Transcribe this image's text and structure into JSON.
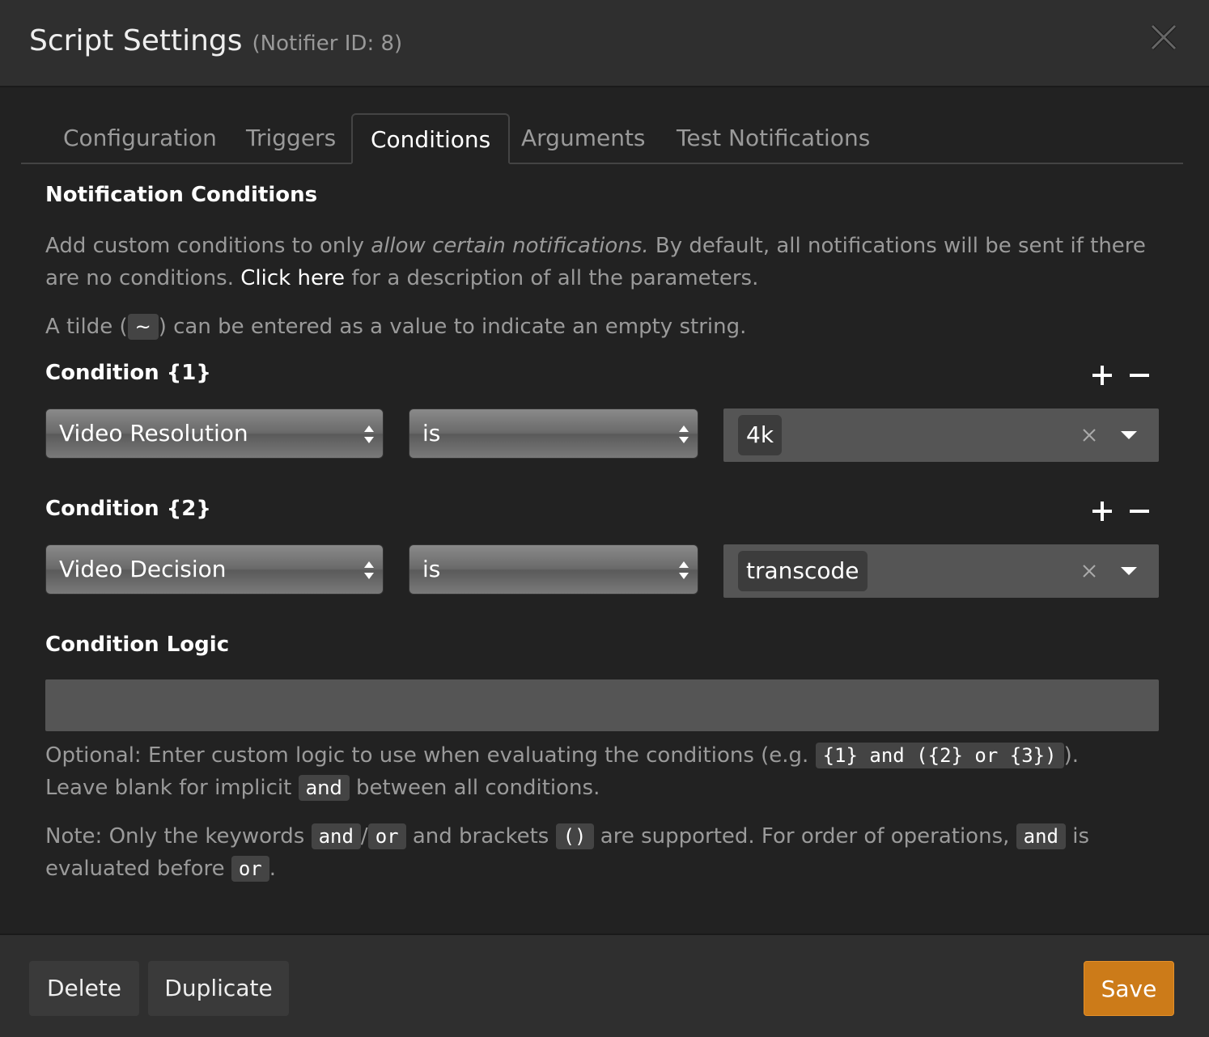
{
  "modal": {
    "title": "Script Settings",
    "subtitle": "(Notifier ID: 8)"
  },
  "tabs": [
    {
      "label": "Configuration",
      "active": false
    },
    {
      "label": "Triggers",
      "active": false
    },
    {
      "label": "Conditions",
      "active": true
    },
    {
      "label": "Arguments",
      "active": false
    },
    {
      "label": "Test Notifications",
      "active": false
    }
  ],
  "notification_conditions": {
    "heading": "Notification Conditions",
    "desc_part1": "Add custom conditions to only ",
    "desc_emph": "allow certain notifications.",
    "desc_part2": " By default, all notifications will be sent if there are no conditions. ",
    "desc_link": "Click here",
    "desc_part3": " for a description of all the parameters.",
    "tilde_part1": "A tilde (",
    "tilde_code": "~",
    "tilde_part2": ") can be entered as a value to indicate an empty string."
  },
  "conditions": [
    {
      "label": "Condition {1}",
      "parameter": "Video Resolution",
      "operator": "is",
      "value": "4k"
    },
    {
      "label": "Condition {2}",
      "parameter": "Video Decision",
      "operator": "is",
      "value": "transcode"
    }
  ],
  "condition_logic": {
    "heading": "Condition Logic",
    "value": "",
    "help1_part1": "Optional: Enter custom logic to use when evaluating the conditions (e.g. ",
    "help1_code": "{1} and ({2} or {3})",
    "help1_part2": ").",
    "help2_part1": "Leave blank for implicit ",
    "help2_code": "and",
    "help2_part2": " between all conditions.",
    "note_part1": "Note: Only the keywords ",
    "note_code_and": "and",
    "note_slash": "/",
    "note_code_or": "or",
    "note_part2": " and brackets ",
    "note_code_brackets": "()",
    "note_part3": " are supported. For order of operations, ",
    "note_code_and2": "and",
    "note_part4": " is evaluated before ",
    "note_code_or2": "or",
    "note_part5": "."
  },
  "footer": {
    "delete_label": "Delete",
    "duplicate_label": "Duplicate",
    "save_label": "Save"
  },
  "colors": {
    "accent": "#cc7b19",
    "background": "#222222",
    "header": "#2f2f2f"
  },
  "icons": [
    "close-icon",
    "plus-icon",
    "minus-icon",
    "select-arrows-icon",
    "clear-icon",
    "caret-down-icon"
  ]
}
